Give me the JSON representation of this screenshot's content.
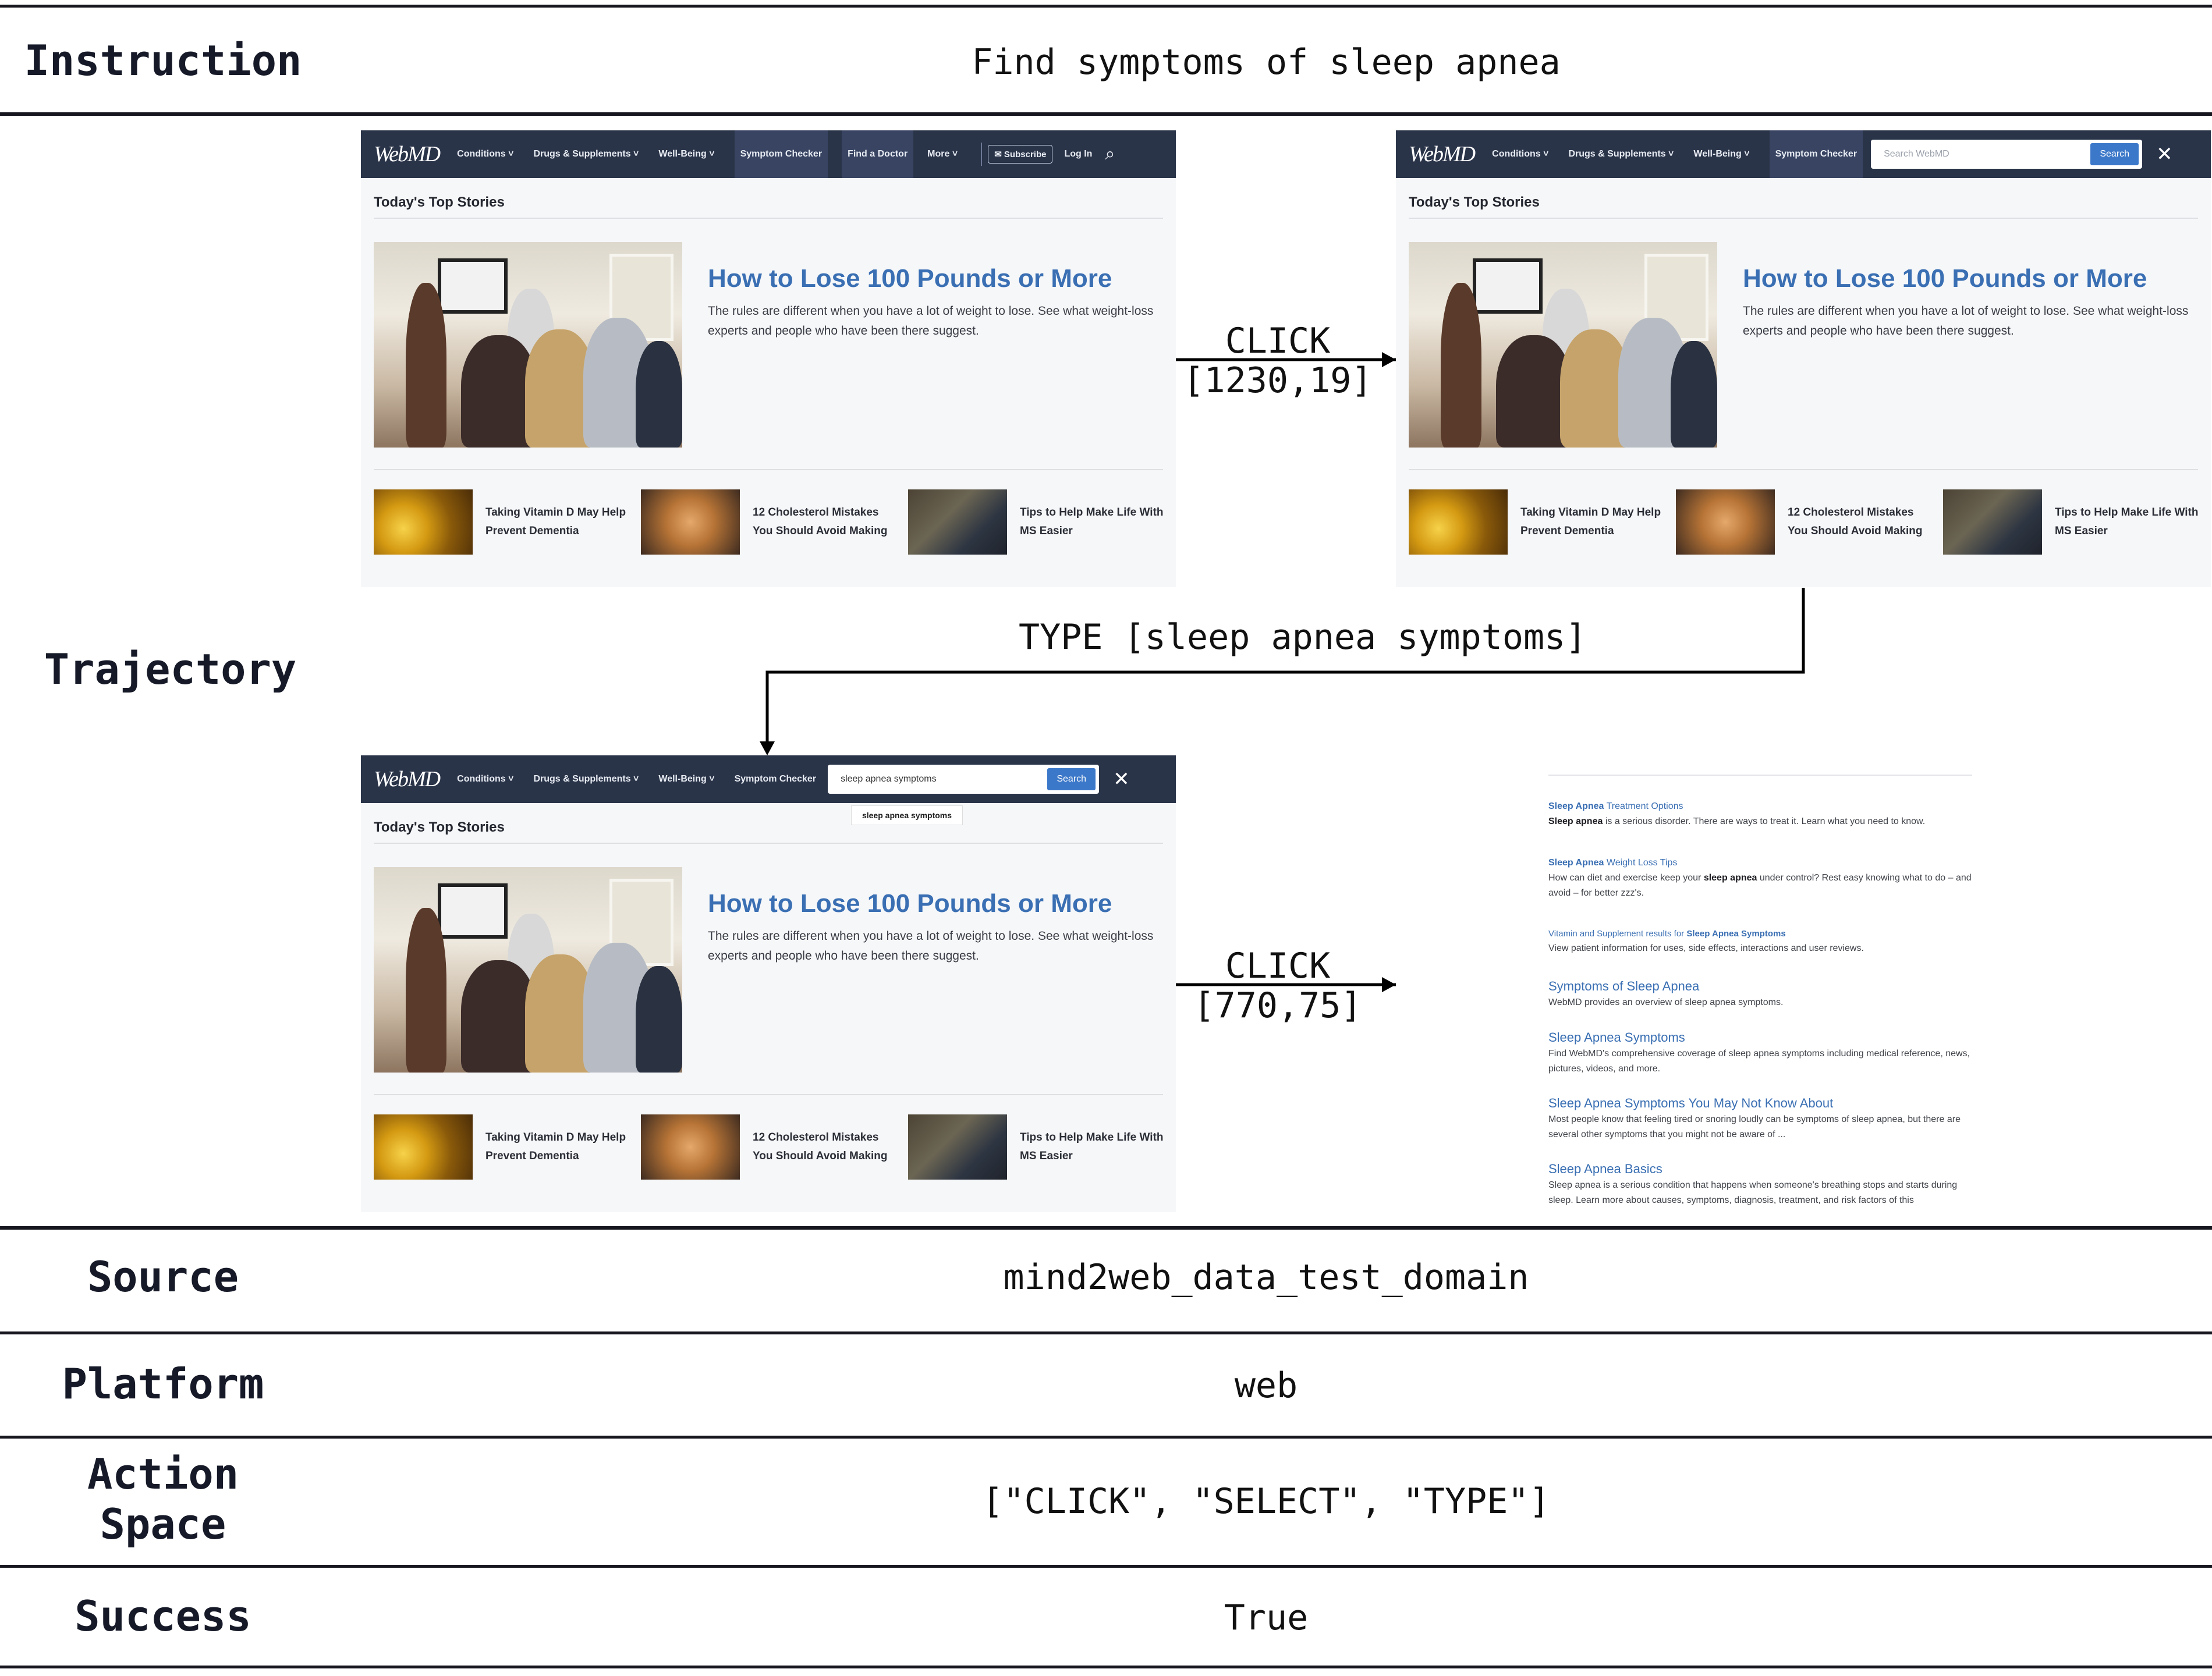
{
  "header": {
    "instruction_label": "Instruction",
    "instruction_text": "Find symptoms of sleep apnea",
    "trajectory_label": "Trajectory"
  },
  "webmd": {
    "logo": "WebMD",
    "nav": {
      "conditions": "Conditions ˅",
      "drugs": "Drugs & Supplements ˅",
      "wellbeing": "Well-Being ˅",
      "symptom_checker": "Symptom Checker",
      "find_doctor": "Find a Doctor",
      "more": "More ˅",
      "subscribe": "✉ Subscribe",
      "login": "Log In",
      "search_icon": "⌕"
    },
    "search_placeholder": "Search WebMD",
    "search_button": "Search",
    "close": "✕",
    "typed_query": "sleep apnea symptoms",
    "suggestion": "sleep apnea symptoms",
    "section_title": "Today's Top Stories",
    "headline": "How to Lose 100 Pounds or More",
    "headline_desc": "The rules are different when you have a lot of weight to lose. See what weight-loss experts and people who have been there suggest.",
    "cards": [
      {
        "title": "Taking Vitamin D May Help Prevent Dementia"
      },
      {
        "title": "12 Cholesterol Mistakes You Should Avoid Making"
      },
      {
        "title": "Tips to Help Make Life With MS Easier"
      }
    ]
  },
  "actions": {
    "a1": [
      "CLICK",
      "[1230,19]"
    ],
    "a2": "TYPE [sleep apnea symptoms]",
    "a3": [
      "CLICK",
      "[770,75]"
    ]
  },
  "results": [
    {
      "link_bold": "Sleep Apnea",
      "link_rest": " Treatment Options",
      "desc_bold": "Sleep apnea",
      "desc_rest": " is a serious disorder. There are ways to treat it. Learn what you need to know."
    },
    {
      "link_bold": "Sleep Apnea",
      "link_rest": " Weight Loss Tips",
      "desc_pre": "How can diet and exercise keep your ",
      "desc_bold": "sleep apnea",
      "desc_rest": " under control? Rest easy knowing what to do – and avoid – for better zzz's."
    },
    {
      "link_pre": "Vitamin and Supplement results for ",
      "link_bold": "Sleep Apnea Symptoms",
      "desc_rest": "View patient information for uses, side effects, interactions and user reviews."
    },
    {
      "link": "Symptoms of Sleep Apnea",
      "desc": "WebMD provides an overview of sleep apnea symptoms."
    },
    {
      "link": "Sleep Apnea Symptoms",
      "desc": "Find WebMD's comprehensive coverage of sleep apnea symptoms including medical reference, news, pictures, videos, and more."
    },
    {
      "link": "Sleep Apnea Symptoms You May Not Know About",
      "desc": "Most people know that feeling tired or snoring loudly can be symptoms of sleep apnea, but there are several other symptoms that you might not be aware of ..."
    },
    {
      "link": "Sleep Apnea Basics",
      "desc": "Sleep apnea is a serious condition that happens when someone's breathing stops and starts during sleep. Learn more about causes, symptoms, diagnosis, treatment, and risk factors of this"
    }
  ],
  "meta": {
    "source_label": "Source",
    "source_value": "mind2web_data_test_domain",
    "platform_label": "Platform",
    "platform_value": "web",
    "action_space_label_1": "Action",
    "action_space_label_2": "Space",
    "action_space_value": "[\"CLICK\", \"SELECT\", \"TYPE\"]",
    "success_label": "Success",
    "success_value": "True"
  }
}
